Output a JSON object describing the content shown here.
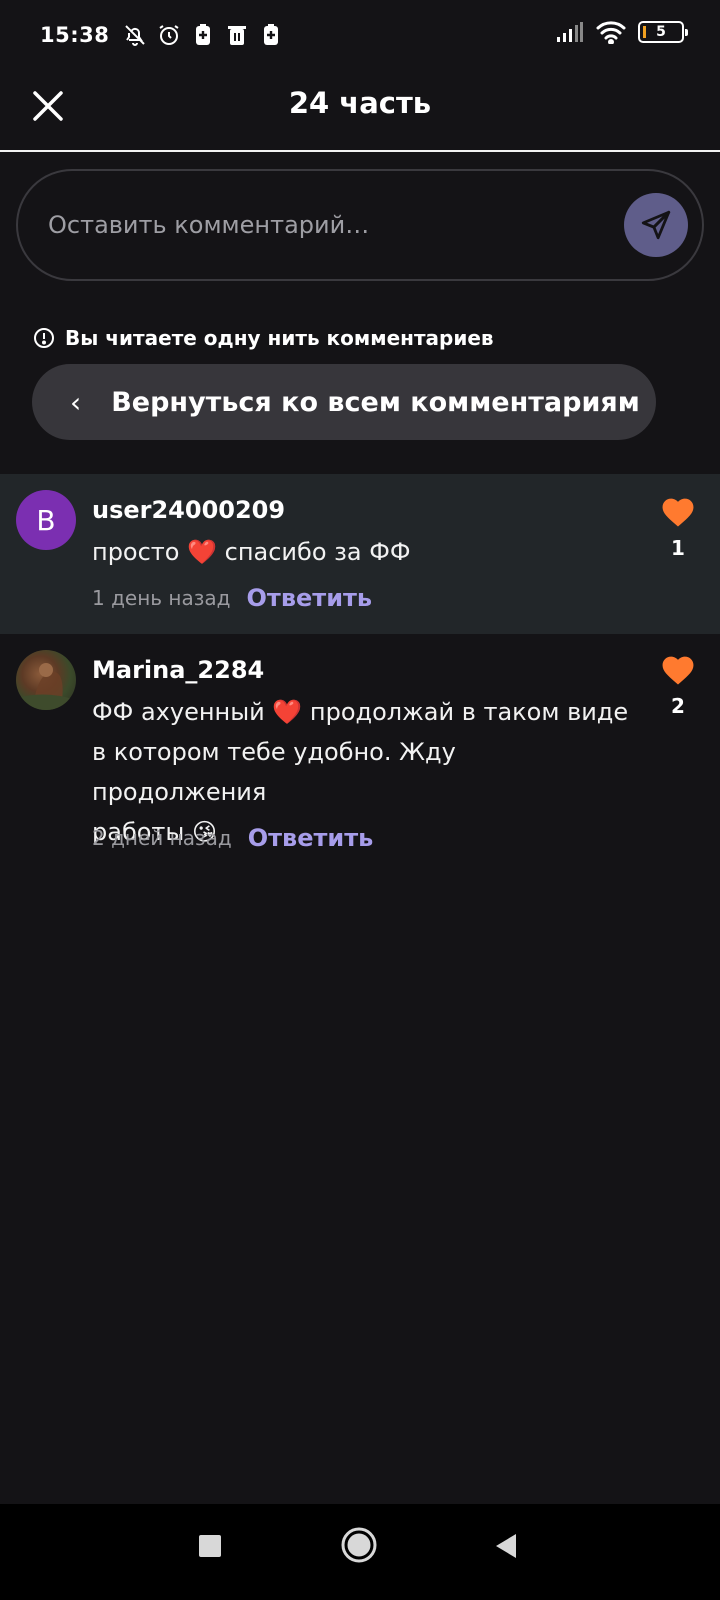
{
  "status": {
    "time": "15:38",
    "battery": "5"
  },
  "header": {
    "title": "24 часть"
  },
  "comment_input": {
    "placeholder": "Оставить комментарий…"
  },
  "thread": {
    "notice": "Вы читаете одну нить комментариев",
    "back_label": "Вернуться ко всем комментариям"
  },
  "comments": [
    {
      "avatar_letter": "В",
      "author": "user24000209",
      "text_before": "просто ",
      "emoji": "❤️",
      "text_after": " спасибо за ФФ",
      "time": "1 день назад",
      "reply": "Ответить",
      "likes": "1"
    },
    {
      "author": "Marina_2284",
      "line1_before": "ФФ ахуенный ",
      "line1_emoji": "❤️",
      "line1_after": " продолжай в таком виде",
      "line2": "в котором тебе удобно. Жду продолжения",
      "line3_before": "работы ",
      "line3_emoji": "😘",
      "time": "2 дней назад",
      "reply": "Ответить",
      "likes": "2"
    }
  ],
  "colors": {
    "background": "#141316",
    "accent": "#a79dea",
    "like": "#ff7a2f",
    "send": "#5f5d8a"
  }
}
